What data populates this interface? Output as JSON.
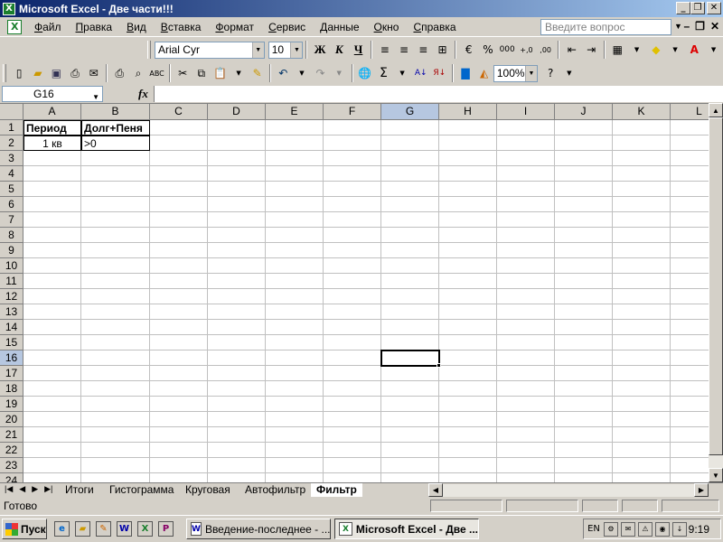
{
  "window": {
    "title": "Microsoft Excel - Две части!!!",
    "icon": "excel-icon"
  },
  "menu": {
    "items": [
      "Файл",
      "Правка",
      "Вид",
      "Вставка",
      "Формат",
      "Сервис",
      "Данные",
      "Окно",
      "Справка"
    ],
    "help_placeholder": "Введите вопрос"
  },
  "format_toolbar": {
    "font": "Arial Cyr",
    "size": "10",
    "bold": "Ж",
    "italic": "К",
    "underline": "Ч"
  },
  "standard_toolbar": {
    "zoom": "100%"
  },
  "formula_bar": {
    "name_box": "G16",
    "fx_label": "fx",
    "formula": ""
  },
  "grid": {
    "columns": [
      "A",
      "B",
      "C",
      "D",
      "E",
      "F",
      "G",
      "H",
      "I",
      "J",
      "K",
      "L"
    ],
    "rows": [
      "1",
      "2",
      "3",
      "4",
      "5",
      "6",
      "7",
      "8",
      "9",
      "10",
      "11",
      "12",
      "13",
      "14",
      "15",
      "16",
      "17",
      "18",
      "19",
      "20",
      "21",
      "22",
      "23",
      "24"
    ],
    "cells": {
      "A1": "Период",
      "B1": "Долг+Пеня",
      "A2": "1 кв",
      "B2": ">0"
    },
    "active_cell": "G16"
  },
  "sheets": {
    "tabs": [
      "Итоги",
      "Гистограмма",
      "Круговая",
      "Автофильтр",
      "Фильтр"
    ],
    "active": "Фильтр"
  },
  "status": {
    "text": "Готово"
  },
  "taskbar": {
    "start_label": "Пуск",
    "tasks": [
      {
        "label": "Введение-последнее - ...",
        "icon": "word-icon"
      },
      {
        "label": "Microsoft Excel - Две ...",
        "icon": "excel-icon"
      }
    ],
    "lang": "EN",
    "clock": "9:19"
  }
}
